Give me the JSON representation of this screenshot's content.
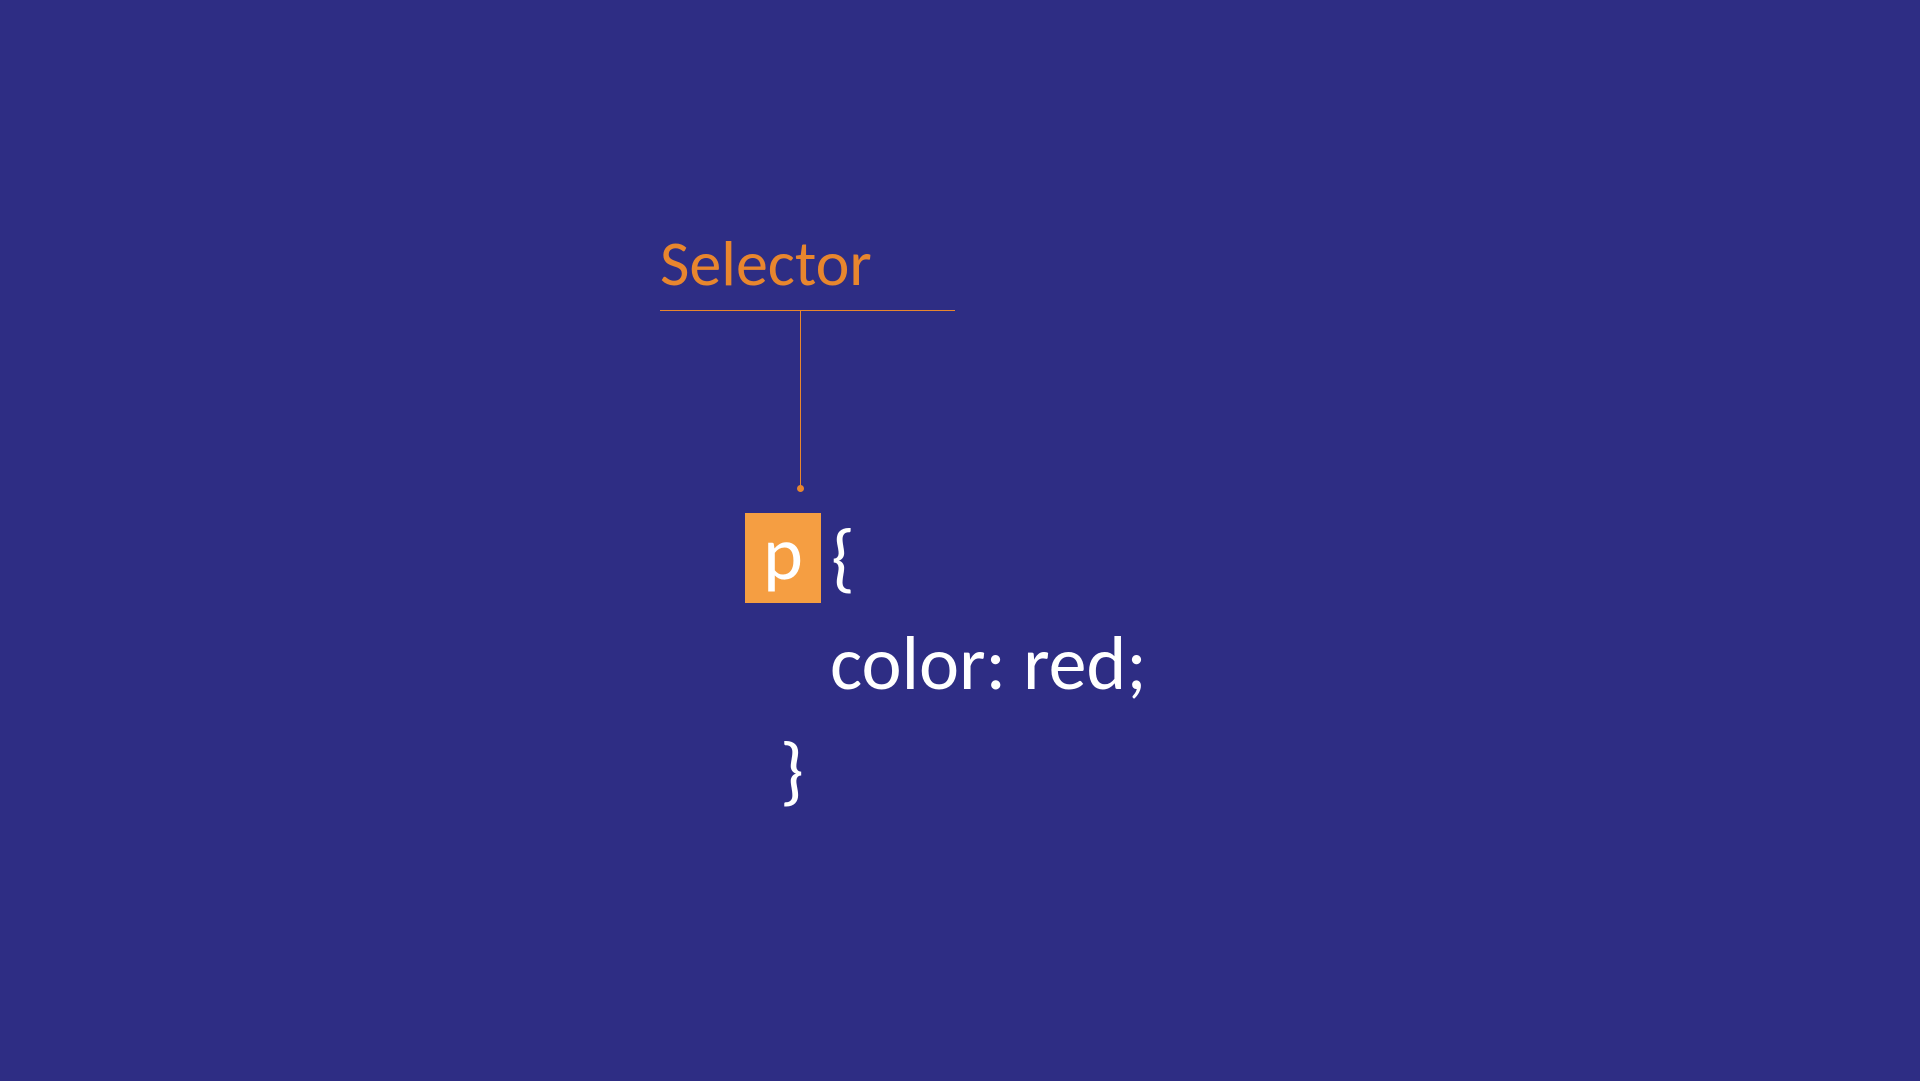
{
  "diagram": {
    "label": "Selector",
    "code": {
      "selector": "p",
      "brace_open": "{",
      "declaration": "color: red;",
      "brace_close": "}"
    },
    "colors": {
      "background": "#2e2d84",
      "accent": "#e8862e",
      "highlight": "#f59e42",
      "text": "#ffffff"
    }
  }
}
